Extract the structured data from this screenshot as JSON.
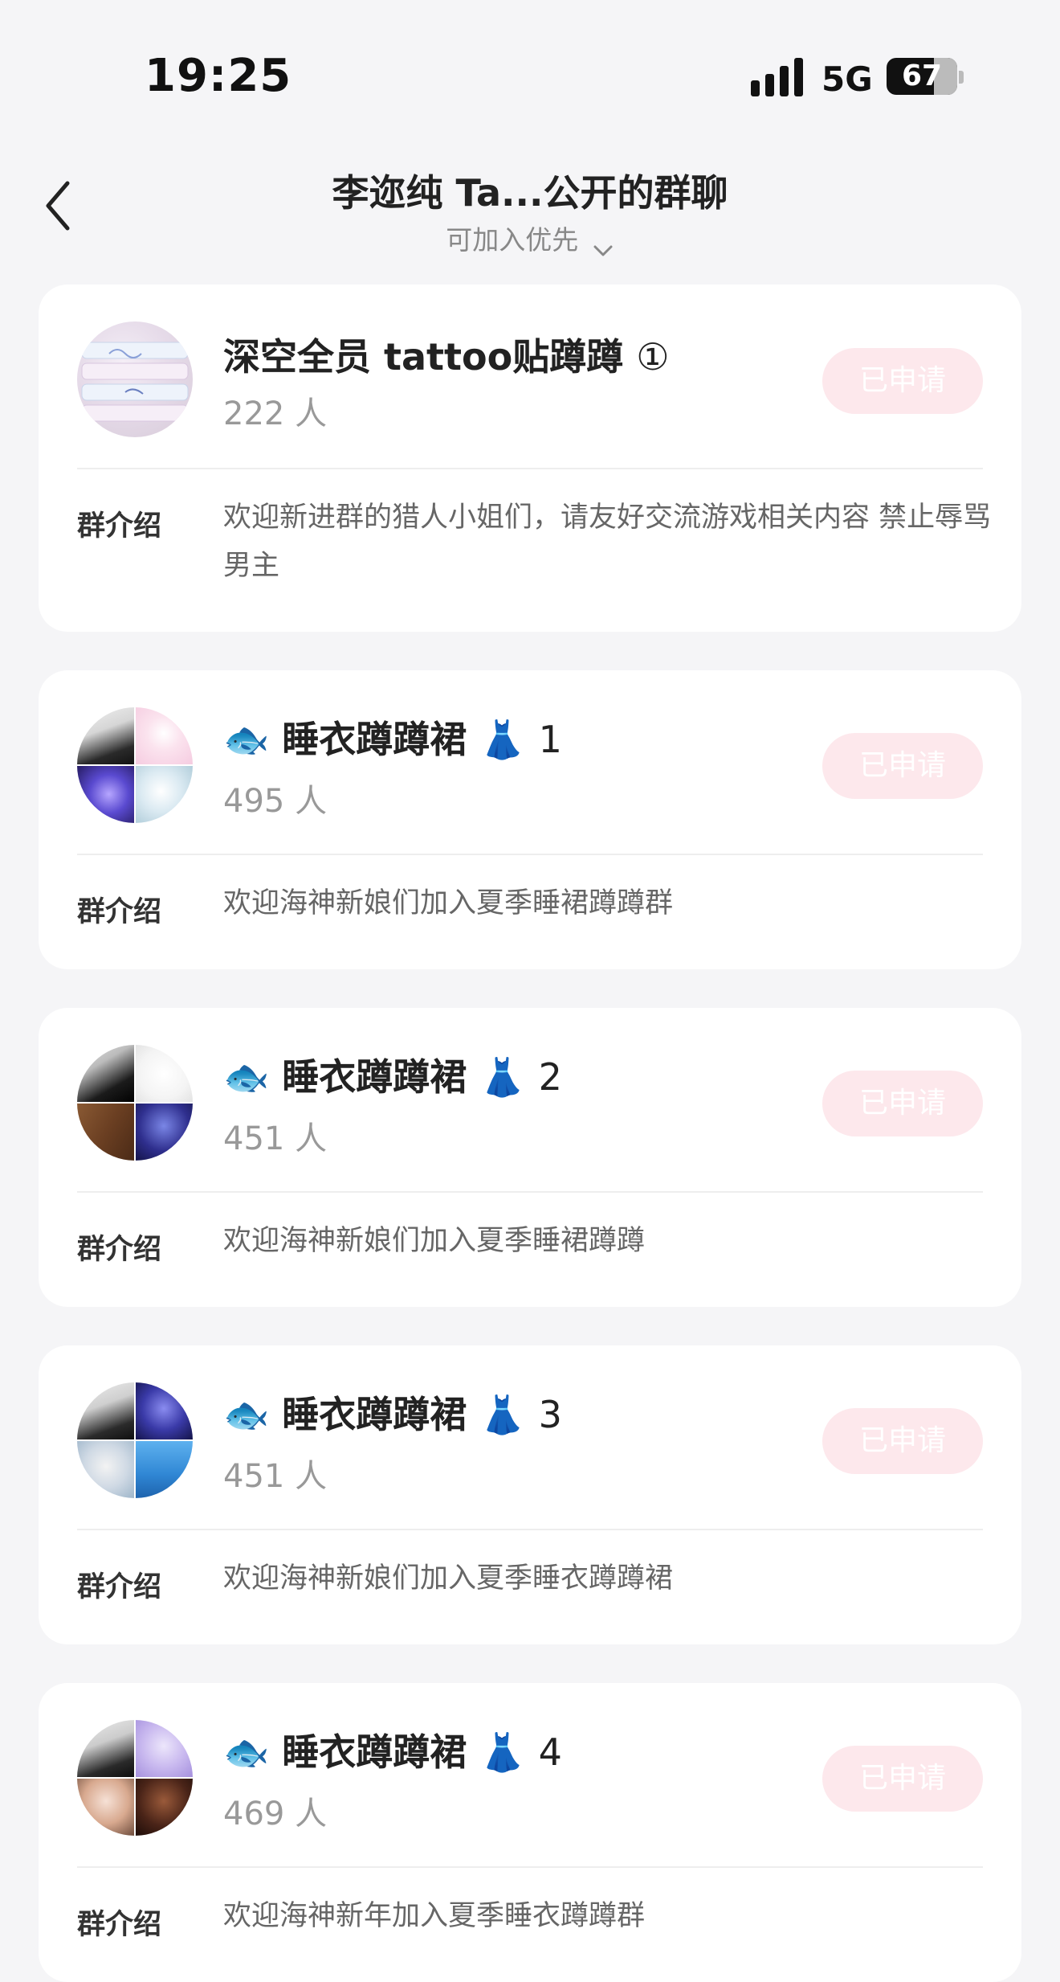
{
  "status": {
    "time": "19:25",
    "network": "5G",
    "battery": "67",
    "battery_level": 0.67
  },
  "nav": {
    "title": "李迩纯 Ta...公开的群聊",
    "subtitle": "可加入优先",
    "back_icon": "chevron-left-icon",
    "subtitle_icon": "chevron-down-icon"
  },
  "groups": [
    {
      "name": "深空全员 tattoo贴蹲蹲",
      "badge": "①",
      "members": "222 人",
      "button": "已申请",
      "intro_label": "群介绍",
      "intro": "欢迎新进群的猎人小姐们，请友好交流游戏相关内容 禁止辱骂男主"
    },
    {
      "name_prefix": "🐟",
      "name": "睡衣蹲蹲裙",
      "name_suffix": "👗",
      "number": "1",
      "members": "495 人",
      "button": "已申请",
      "intro_label": "群介绍",
      "intro": "欢迎海神新娘们加入夏季睡裙蹲蹲群"
    },
    {
      "name_prefix": "🐟",
      "name": "睡衣蹲蹲裙",
      "name_suffix": "👗",
      "number": "2",
      "members": "451 人",
      "button": "已申请",
      "intro_label": "群介绍",
      "intro": "欢迎海神新娘们加入夏季睡裙蹲蹲"
    },
    {
      "name_prefix": "🐟",
      "name": "睡衣蹲蹲裙",
      "name_suffix": "👗",
      "number": "3",
      "members": "451 人",
      "button": "已申请",
      "intro_label": "群介绍",
      "intro": "欢迎海神新娘们加入夏季睡衣蹲蹲裙"
    },
    {
      "name_prefix": "🐟",
      "name": "睡衣蹲蹲裙",
      "name_suffix": "👗",
      "number": "4",
      "members": "469 人",
      "button": "已申请",
      "intro_label": "群介绍",
      "intro": "欢迎海神新年加入夏季睡衣蹲蹲群"
    }
  ],
  "colors": {
    "background": "#f5f5f7",
    "card": "#ffffff",
    "applied_button_bg": "#fde8ec",
    "applied_button_text": "#ffffff",
    "muted_text": "#999999"
  }
}
